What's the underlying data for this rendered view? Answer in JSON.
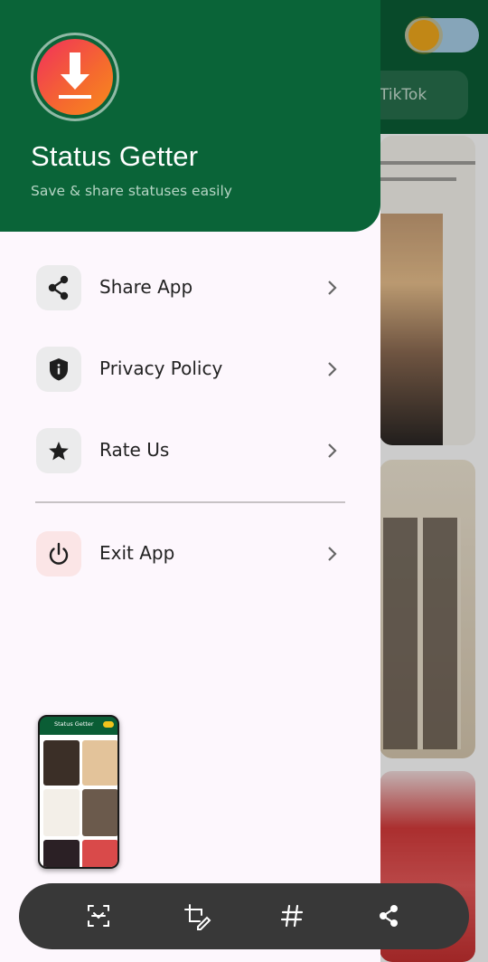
{
  "background": {
    "tab_label": "TikTok"
  },
  "drawer": {
    "app_name": "Status Getter",
    "tagline": "Save & share statuses easily",
    "logo_icon": "download-arrow-icon",
    "items": [
      {
        "label": "Share App",
        "icon": "share-icon"
      },
      {
        "label": "Privacy Policy",
        "icon": "shield-icon"
      },
      {
        "label": "Rate Us",
        "icon": "star-icon"
      },
      {
        "label": "Exit App",
        "icon": "power-icon"
      }
    ]
  },
  "preview": {
    "title": "Status Getter"
  },
  "action_bar": {
    "buttons": [
      {
        "icon": "scan-icon"
      },
      {
        "icon": "crop-edit-icon"
      },
      {
        "icon": "hashtag-icon"
      },
      {
        "icon": "share-icon"
      }
    ]
  },
  "colors": {
    "drawer_header": "#0a6438",
    "drawer_background": "#fdf7fd",
    "logo_gradient_start": "#f0305c",
    "logo_gradient_end": "#f78c1c",
    "exit_icon_background": "#fbe5e6",
    "action_bar": "#383838"
  }
}
